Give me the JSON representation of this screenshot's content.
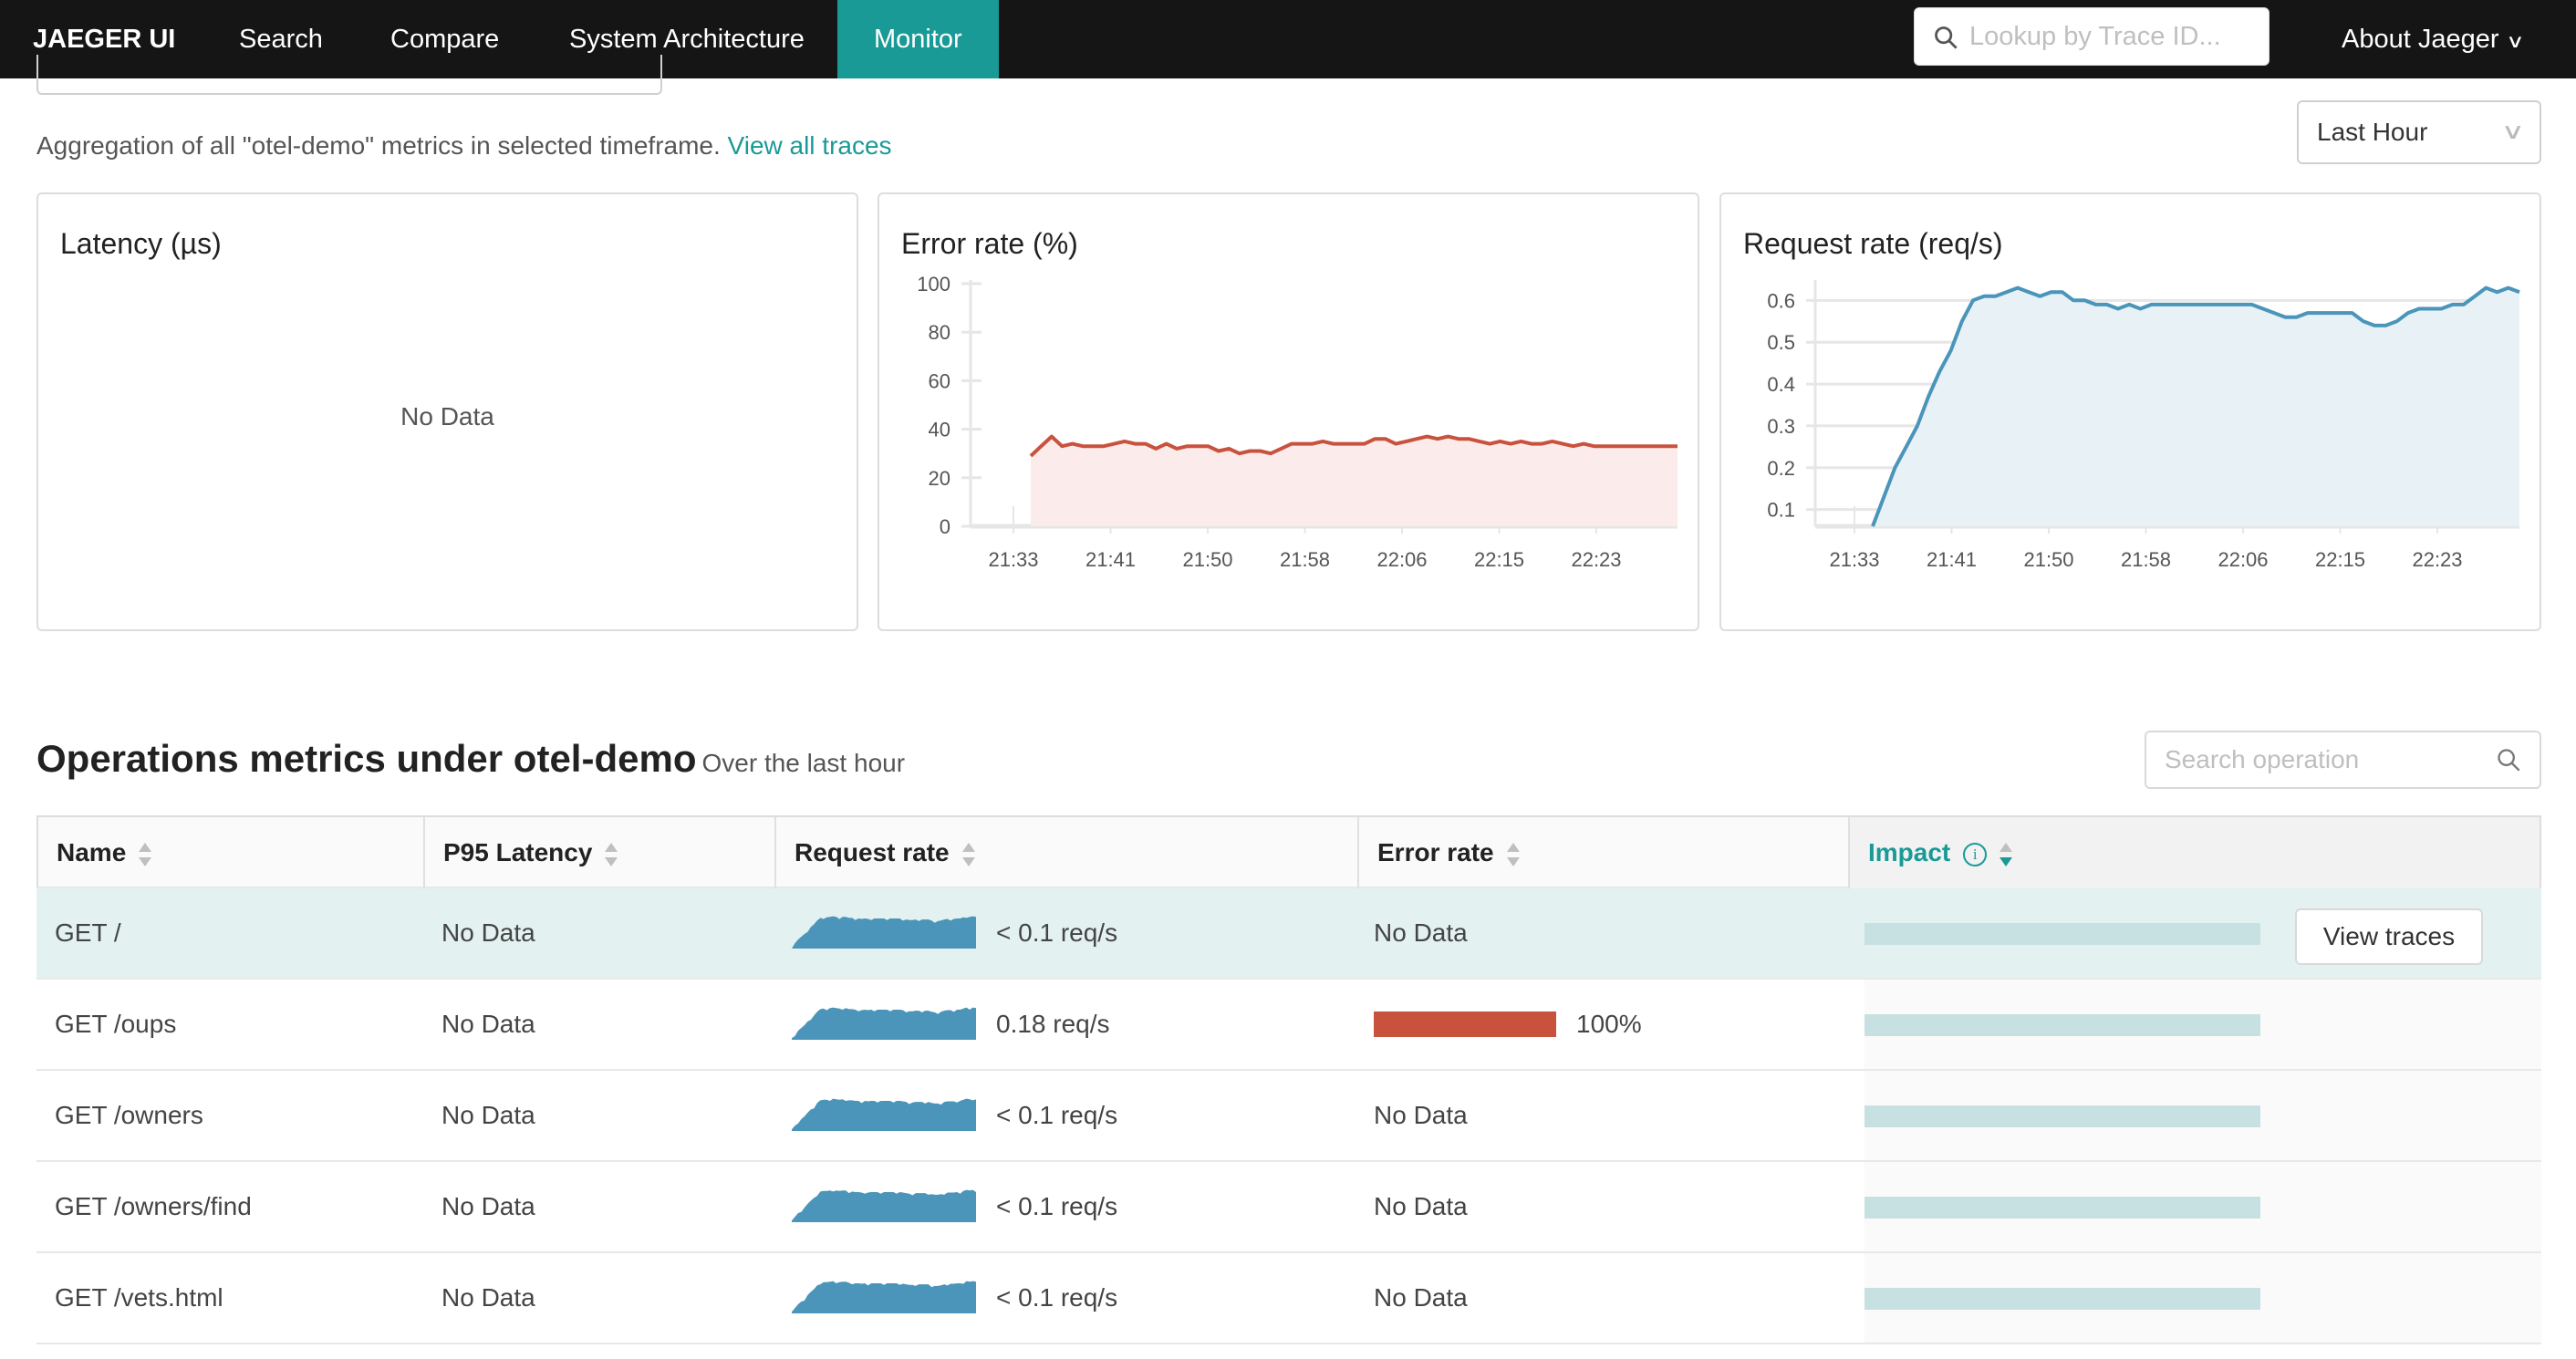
{
  "nav": {
    "brand": "JAEGER UI",
    "items": [
      {
        "label": "Search",
        "active": false
      },
      {
        "label": "Compare",
        "active": false
      },
      {
        "label": "System Architecture",
        "active": false
      },
      {
        "label": "Monitor",
        "active": true
      }
    ],
    "trace_lookup_placeholder": "Lookup by Trace ID...",
    "about_label": "About Jaeger"
  },
  "summary": {
    "text": "Aggregation of all \"otel-demo\" metrics in selected timeframe.",
    "link": "View all traces",
    "timeframe": "Last Hour"
  },
  "panels": {
    "latency": {
      "title": "Latency (µs)",
      "empty_text": "No Data"
    },
    "error_rate": {
      "title": "Error rate (%)"
    },
    "request_rate": {
      "title": "Request rate (req/s)"
    }
  },
  "chart_data": [
    {
      "type": "area",
      "title": "Error rate (%)",
      "color": "#c9523e",
      "fill": "#fbeceb",
      "ylim": [
        0,
        100
      ],
      "yticks": [
        0,
        20,
        40,
        60,
        80,
        100
      ],
      "xticks": [
        "21:33",
        "21:41",
        "21:50",
        "21:58",
        "22:06",
        "22:15",
        "22:23"
      ],
      "xrange_minutes": [
        0,
        64
      ],
      "grid": false,
      "x_minutes": [
        1.5,
        2.5,
        3.5,
        4,
        4.5,
        5,
        5.5,
        6,
        6.5,
        7,
        7.5,
        8,
        8.5,
        9,
        9.5,
        10,
        10.5,
        11,
        11.5,
        12,
        12.5,
        13,
        13.5,
        14,
        14.5,
        15,
        15.5,
        16,
        16.5,
        17,
        17.5,
        18,
        18.5,
        19,
        19.5,
        20,
        20.5,
        21,
        21.5,
        22,
        22.5,
        23,
        23.5,
        24,
        24.5,
        25,
        25.5,
        26,
        26.5,
        27,
        27.5,
        28,
        28.5,
        29,
        29.5,
        30,
        30.5,
        31,
        31.5,
        32,
        32.5,
        33,
        33.5
      ],
      "values": [
        29,
        33,
        37,
        33,
        34,
        33,
        33,
        33,
        34,
        35,
        34,
        34,
        32,
        34,
        32,
        33,
        33,
        33,
        31,
        32,
        30,
        31,
        31,
        30,
        32,
        34,
        34,
        34,
        35,
        34,
        34,
        34,
        34,
        36,
        36,
        34,
        35,
        36,
        37,
        36,
        37,
        36,
        36,
        35,
        34,
        35,
        34,
        35,
        34,
        34,
        35,
        34,
        33,
        34,
        33,
        33,
        33,
        33,
        33,
        33,
        33,
        33,
        33
      ]
    },
    {
      "type": "area",
      "title": "Request rate (req/s)",
      "color": "#4a95b9",
      "fill": "#e8f1f6",
      "ylim": [
        0.06,
        0.64
      ],
      "yticks": [
        0.1,
        0.2,
        0.3,
        0.4,
        0.5,
        0.6
      ],
      "xticks": [
        "21:33",
        "21:41",
        "21:50",
        "21:58",
        "22:06",
        "22:15",
        "22:23"
      ],
      "grid": true,
      "values": [
        0.06,
        0.13,
        0.2,
        0.25,
        0.3,
        0.37,
        0.43,
        0.48,
        0.55,
        0.6,
        0.61,
        0.61,
        0.62,
        0.63,
        0.62,
        0.61,
        0.62,
        0.62,
        0.6,
        0.6,
        0.59,
        0.59,
        0.58,
        0.59,
        0.58,
        0.59,
        0.59,
        0.59,
        0.59,
        0.59,
        0.59,
        0.59,
        0.59,
        0.59,
        0.59,
        0.58,
        0.57,
        0.56,
        0.56,
        0.57,
        0.57,
        0.57,
        0.57,
        0.57,
        0.55,
        0.54,
        0.54,
        0.55,
        0.57,
        0.58,
        0.58,
        0.58,
        0.59,
        0.59,
        0.61,
        0.63,
        0.62,
        0.63,
        0.62
      ]
    }
  ],
  "operations": {
    "title": "Operations metrics under otel-demo",
    "subtitle": "Over the last hour",
    "search_placeholder": "Search operation",
    "columns": [
      "Name",
      "P95 Latency",
      "Request rate",
      "Error rate",
      "Impact"
    ],
    "view_traces_label": "View traces",
    "rows": [
      {
        "name": "GET /",
        "p95": "No Data",
        "request_rate": "< 0.1 req/s",
        "error_rate": "No Data",
        "error_pct": null,
        "impact": 1.0,
        "highlighted": true
      },
      {
        "name": "GET /oups",
        "p95": "No Data",
        "request_rate": "0.18 req/s",
        "error_rate": "100%",
        "error_pct": 100,
        "impact": 1.0,
        "highlighted": false
      },
      {
        "name": "GET /owners",
        "p95": "No Data",
        "request_rate": "< 0.1 req/s",
        "error_rate": "No Data",
        "error_pct": null,
        "impact": 1.0,
        "highlighted": false
      },
      {
        "name": "GET /owners/find",
        "p95": "No Data",
        "request_rate": "< 0.1 req/s",
        "error_rate": "No Data",
        "error_pct": null,
        "impact": 1.0,
        "highlighted": false
      },
      {
        "name": "GET /vets.html",
        "p95": "No Data",
        "request_rate": "< 0.1 req/s",
        "error_rate": "No Data",
        "error_pct": null,
        "impact": 1.0,
        "highlighted": false
      }
    ]
  },
  "colors": {
    "accent": "#199a96",
    "nav_bg": "#151515",
    "error": "#c9523e",
    "request": "#4a95b9",
    "impact": "#c7e1e2",
    "row_highlight": "#e3f1f1"
  }
}
